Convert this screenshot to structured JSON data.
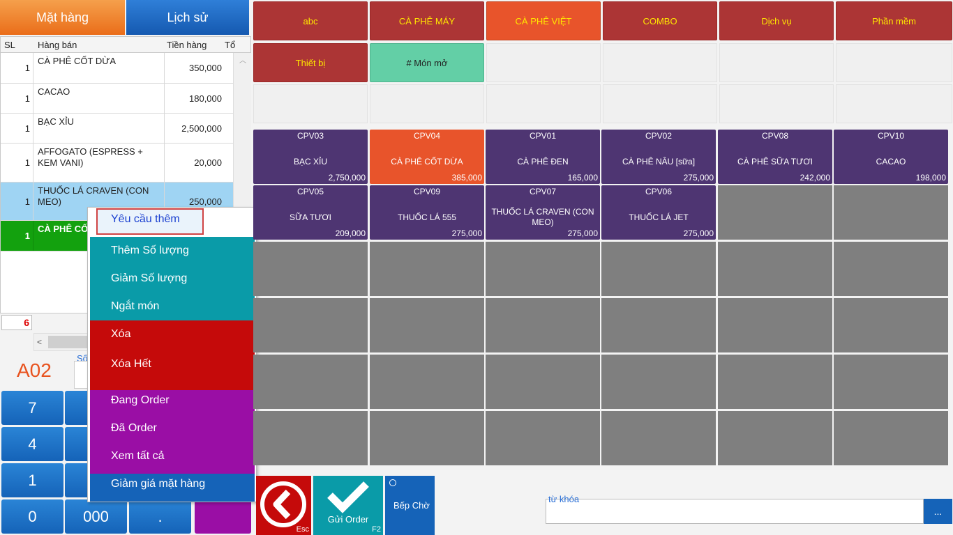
{
  "tabs": {
    "items": "Mặt hàng",
    "history": "Lịch sử"
  },
  "order_table": {
    "headers": [
      "SL",
      "Hàng bán",
      "Tiền hàng",
      "Tổ"
    ],
    "rows": [
      {
        "qty": "1",
        "name": "CÀ PHÊ CỐT DỪA",
        "price": "350,000"
      },
      {
        "qty": "1",
        "name": "CACAO",
        "price": "180,000"
      },
      {
        "qty": "1",
        "name": "BẠC XỈU",
        "price": "2,500,000"
      },
      {
        "qty": "1",
        "name": "AFFOGATO (ESPRESS + KEM VANI)",
        "price": "20,000"
      },
      {
        "qty": "1",
        "name": " THUỐC LÁ CRAVEN  (CON MEO)",
        "price": "250,000"
      },
      {
        "qty": "1",
        "name": "CÀ PHÊ CỐ",
        "price": ""
      }
    ],
    "count": "6"
  },
  "table_code": "A02",
  "so_label": "Số",
  "keypad": [
    "7",
    "4",
    "1",
    "0",
    "000",
    "."
  ],
  "context_menu": {
    "items": [
      "Yêu cầu thêm",
      "Thêm Số lượng",
      "Giảm Số lượng",
      "Ngắt món",
      "Xóa",
      "Xóa Hết",
      "Đang Order",
      "Đã Order",
      "Xem tất cả",
      "Giảm giá mặt hàng"
    ]
  },
  "categories": [
    "abc",
    "CÀ PHÊ MÁY",
    "CÀ PHÊ VIỆT",
    "COMBO",
    "Dịch vụ",
    "Phần mềm",
    "Thiết bị",
    "# Món mở"
  ],
  "products": [
    {
      "code": "CPV03",
      "name": "BẠC XỈU",
      "price": "2,750,000"
    },
    {
      "code": "CPV04",
      "name": "CÀ PHÊ CỐT DỪA",
      "price": "385,000"
    },
    {
      "code": "CPV01",
      "name": "CÀ PHÊ ĐEN",
      "price": "165,000"
    },
    {
      "code": "CPV02",
      "name": "CÀ PHÊ NÂU [sữa]",
      "price": "275,000"
    },
    {
      "code": "CPV08",
      "name": "CÀ PHÊ SỮA TƯƠI",
      "price": "242,000"
    },
    {
      "code": "CPV10",
      "name": "CACAO",
      "price": "198,000"
    },
    {
      "code": "CPV05",
      "name": "SỮA TƯƠI",
      "price": "209,000"
    },
    {
      "code": "CPV09",
      "name": "THUỐC LÁ 555",
      "price": "275,000"
    },
    {
      "code": "CPV07",
      "name": "THUỐC LÁ CRAVEN  (CON MEO)",
      "price": "275,000"
    },
    {
      "code": "CPV06",
      "name": "THUỐC LÁ JET",
      "price": "275,000"
    }
  ],
  "actions": {
    "esc": "Esc",
    "send": "Gửi Order",
    "send_key": "F2",
    "kitchen": "Bếp Chờ"
  },
  "search": {
    "label": "từ khóa",
    "button": "..."
  },
  "colors": {
    "category": "#ac3535",
    "category_text": "#ffe700",
    "product": "#4e3572",
    "accent_orange": "#e8542b",
    "teal": "#0a9ba8",
    "red": "#c50a0a",
    "purple": "#9a0ea5",
    "blue": "#1563b8"
  }
}
